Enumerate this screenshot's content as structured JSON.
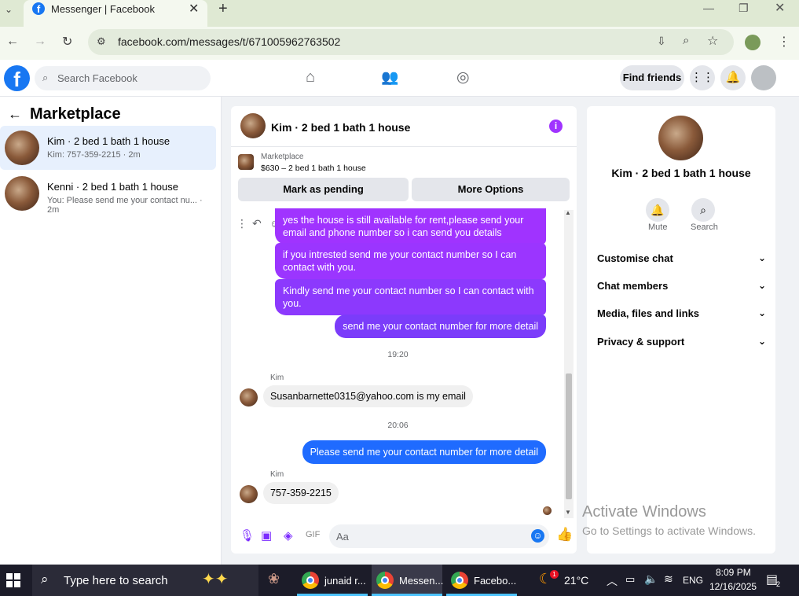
{
  "browser": {
    "tab_title": "Messenger | Facebook",
    "new_tab": "+",
    "url": "facebook.com/messages/t/671005962763502"
  },
  "fb_header": {
    "search_placeholder": "Search Facebook",
    "find_friends": "Find friends"
  },
  "left_panel": {
    "title": "Marketplace",
    "conversations": [
      {
        "name": "Kim · 2 bed 1 bath 1 house",
        "sub": "Kim: 757-359-2215 · 2m",
        "selected": true
      },
      {
        "name": "Kenni · 2 bed 1 bath 1 house",
        "sub": "You: Please send me your contact nu... · 2m",
        "selected": false
      }
    ]
  },
  "chat": {
    "title": "Kim · 2 bed 1 bath 1 house",
    "marketplace_label": "Marketplace",
    "listing": "$630 – 2 bed 1 bath 1 house",
    "mark_pending": "Mark as pending",
    "more_options": "More Options",
    "messages": {
      "out1": "yes the house is still available for rent,please send your email and phone number so i can send you details",
      "out2": "if you intrested send me your contact number so I can contact with you.",
      "out3": "Kindly send me your contact number so I can contact with you.",
      "out4": "send me your contact number for more detail",
      "time1": "19:20",
      "sender1": "Kim",
      "in1": "Susanbarnette0315@yahoo.com is my email",
      "time2": "20:06",
      "out5": "Please send me your contact number for more detail",
      "sender2": "Kim",
      "in2": "757-359-2215"
    },
    "composer_placeholder": "Aa"
  },
  "right_panel": {
    "name": "Kim · 2 bed 1 bath 1 house",
    "mute": "Mute",
    "search": "Search",
    "sections": [
      "Customise chat",
      "Chat members",
      "Media, files and links",
      "Privacy & support"
    ]
  },
  "watermark": {
    "line1": "Activate Windows",
    "line2": "Go to Settings to activate Windows."
  },
  "taskbar": {
    "search_placeholder": "Type here to search",
    "apps": [
      "junaid r...",
      "Messen...",
      "Facebo..."
    ],
    "badge": "1",
    "temperature": "21°C",
    "lang": "ENG",
    "time": "8:09 PM",
    "date": "12/16/2025",
    "notif_count": "2"
  },
  "colors": {
    "fb_blue": "#1877f2",
    "bubble_purple": "#a033ff",
    "bubble_blue": "#1f6bff",
    "tab_bar": "#dfe9d3"
  }
}
